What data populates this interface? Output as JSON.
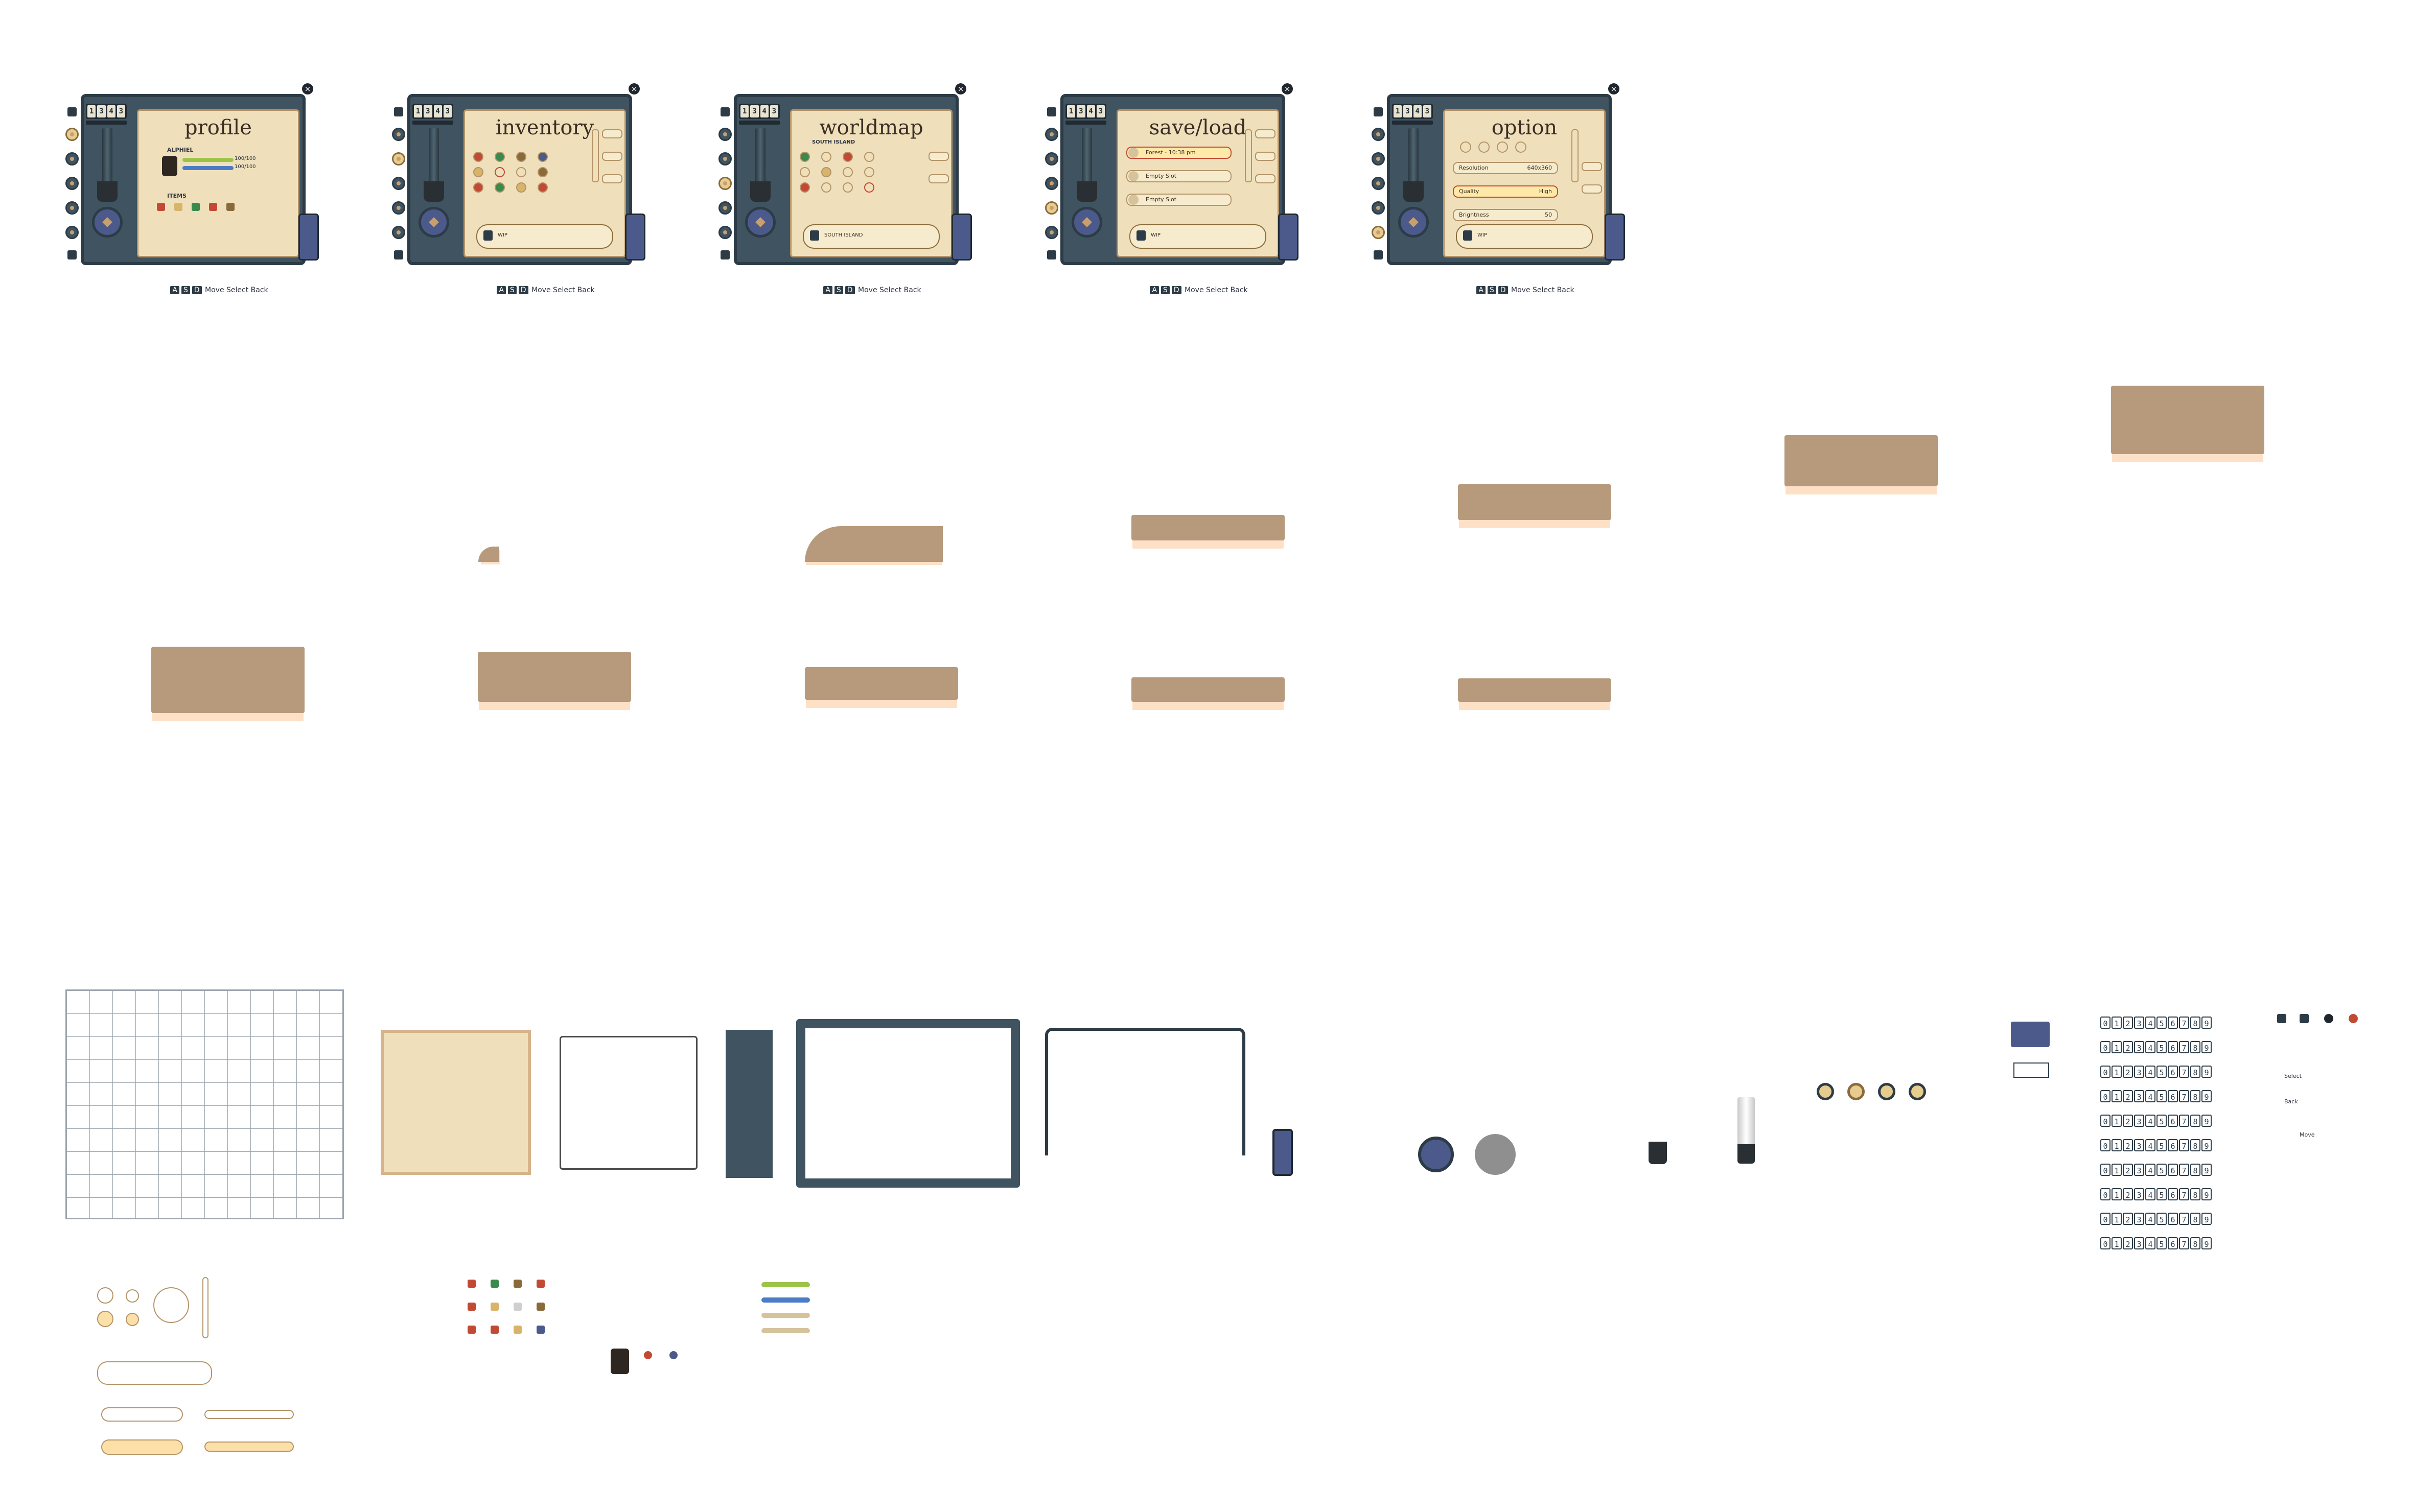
{
  "clock_digits": [
    "1",
    "3",
    "4",
    "3"
  ],
  "screens": [
    {
      "title": "profile",
      "note": "WIP",
      "hint_keys": [
        "A",
        "S",
        "D"
      ],
      "hint_labels": [
        "Move",
        "Select",
        "Back"
      ]
    },
    {
      "title": "inventory",
      "note": "WIP",
      "hint_keys": [
        "A",
        "S",
        "D"
      ],
      "hint_labels": [
        "Move",
        "Select",
        "Back"
      ]
    },
    {
      "title": "worldmap",
      "note": "SOUTH ISLAND",
      "hint_keys": [
        "A",
        "S",
        "D"
      ],
      "hint_labels": [
        "Move",
        "Select",
        "Back"
      ]
    },
    {
      "title": "save/load",
      "note": "WIP",
      "hint_keys": [
        "A",
        "S",
        "D"
      ],
      "hint_labels": [
        "Move",
        "Select",
        "Back"
      ]
    },
    {
      "title": "option",
      "note": "WIP",
      "hint_keys": [
        "A",
        "S",
        "D"
      ],
      "hint_labels": [
        "Move",
        "Select",
        "Back"
      ]
    }
  ],
  "profile": {
    "name": "ALPHIEL",
    "hp": "100/100",
    "mp": "100/100",
    "items_label": "ITEMS"
  },
  "worldmap": {
    "region": "SOUTH ISLAND"
  },
  "saveload": {
    "slots": [
      "Forest - 10:38 pm",
      "Empty Slot",
      "Empty Slot"
    ]
  },
  "option": {
    "rows": [
      {
        "label": "Resolution",
        "value": "640x360"
      },
      {
        "label": "Quality",
        "value": "High"
      },
      {
        "label": "Brightness",
        "value": "50"
      }
    ]
  },
  "digit_rows": [
    "0123456789",
    "0123456789",
    "0123456789",
    "0123456789",
    "0123456789",
    "0123456789",
    "0123456789",
    "0123456789",
    "0123456789",
    "0123456789"
  ],
  "legend": {
    "move": "Move",
    "select": "Select",
    "back": "Back"
  },
  "colors": {
    "frame": "#3f5360",
    "paper": "#efe0bb",
    "accent": "#c24a35",
    "parchment_strip": "#b79a7b"
  }
}
